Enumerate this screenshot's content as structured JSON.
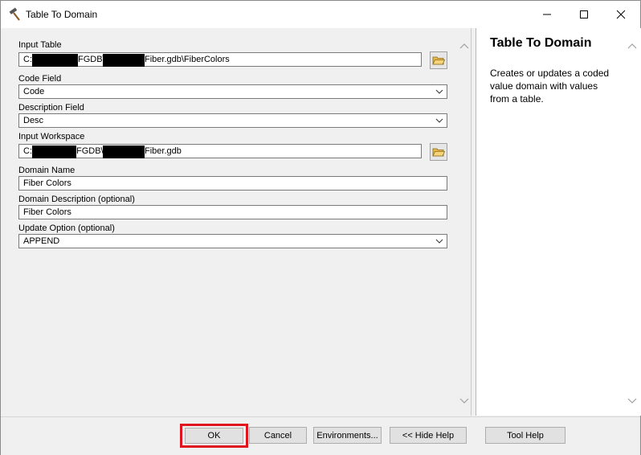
{
  "window": {
    "title": "Table To Domain",
    "icon": "hammer-icon"
  },
  "params": {
    "input_table": {
      "label": "Input Table",
      "value_parts": [
        "C:",
        "FGDB\\",
        "Fiber.gdb\\FiberColors"
      ],
      "browse_icon": "folder-open-icon"
    },
    "code_field": {
      "label": "Code Field",
      "value": "Code"
    },
    "description_field": {
      "label": "Description Field",
      "value": "Desc"
    },
    "input_workspace": {
      "label": "Input Workspace",
      "value_parts": [
        "C:",
        "FGDB\\",
        "Fiber.gdb"
      ],
      "browse_icon": "folder-open-icon"
    },
    "domain_name": {
      "label": "Domain Name",
      "value": "Fiber Colors"
    },
    "domain_description": {
      "label": "Domain Description (optional)",
      "value": "Fiber Colors"
    },
    "update_option": {
      "label": "Update Option (optional)",
      "value": "APPEND"
    }
  },
  "help": {
    "title": "Table To Domain",
    "body": "Creates or updates a coded value domain with values from a table."
  },
  "buttons": {
    "ok": "OK",
    "cancel": "Cancel",
    "environments": "Environments...",
    "hide_help": "<< Hide Help",
    "tool_help": "Tool Help"
  },
  "colors": {
    "highlight": "#e0141e",
    "window_bg": "#f0f0f0",
    "help_bg": "#ffffff"
  }
}
